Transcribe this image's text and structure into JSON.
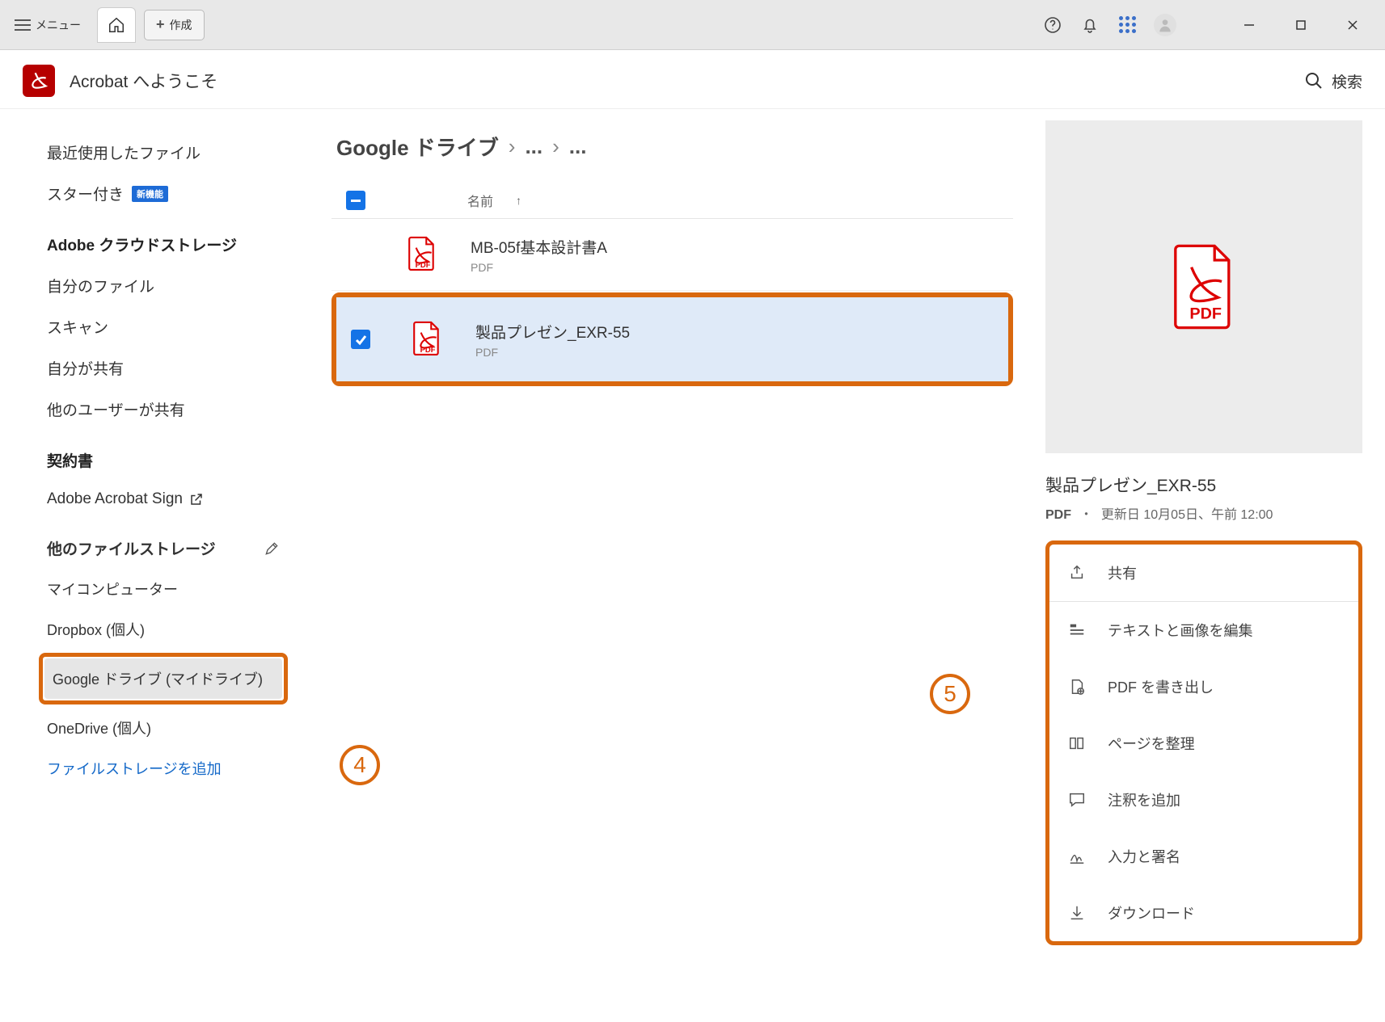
{
  "titlebar": {
    "menu_label": "メニュー",
    "create_label": "作成"
  },
  "subheader": {
    "welcome": "Acrobat へようこそ",
    "search": "検索"
  },
  "sidebar": {
    "recent": "最近使用したファイル",
    "starred": "スター付き",
    "starred_badge": "新機能",
    "section_cloud": "Adobe クラウドストレージ",
    "my_files": "自分のファイル",
    "scan": "スキャン",
    "shared_by_me": "自分が共有",
    "shared_by_others": "他のユーザーが共有",
    "section_contracts": "契約書",
    "acrobat_sign": "Adobe Acrobat Sign",
    "section_storage": "他のファイルストレージ",
    "my_computer": "マイコンピューター",
    "dropbox": "Dropbox (個人)",
    "gdrive": "Google ドライブ (マイドライブ)",
    "onedrive": "OneDrive (個人)",
    "add_storage": "ファイルストレージを追加"
  },
  "callouts": {
    "four": "4",
    "five": "5"
  },
  "breadcrumb": {
    "root": "Google ドライブ",
    "mid": "...",
    "last": "..."
  },
  "list": {
    "col_name": "名前",
    "files": [
      {
        "name": "MB-05f基本設計書A",
        "type": "PDF",
        "selected": false
      },
      {
        "name": "製品プレゼン_EXR-55",
        "type": "PDF",
        "selected": true
      }
    ]
  },
  "detail": {
    "name": "製品プレゼン_EXR-55",
    "meta_type": "PDF",
    "meta_sep": "・",
    "meta_updated": "更新日 10月05日、午前 12:00",
    "actions": {
      "share": "共有",
      "edit": "テキストと画像を編集",
      "export": "PDF を書き出し",
      "organize": "ページを整理",
      "comment": "注釈を追加",
      "fillsign": "入力と署名",
      "download": "ダウンロード"
    }
  }
}
